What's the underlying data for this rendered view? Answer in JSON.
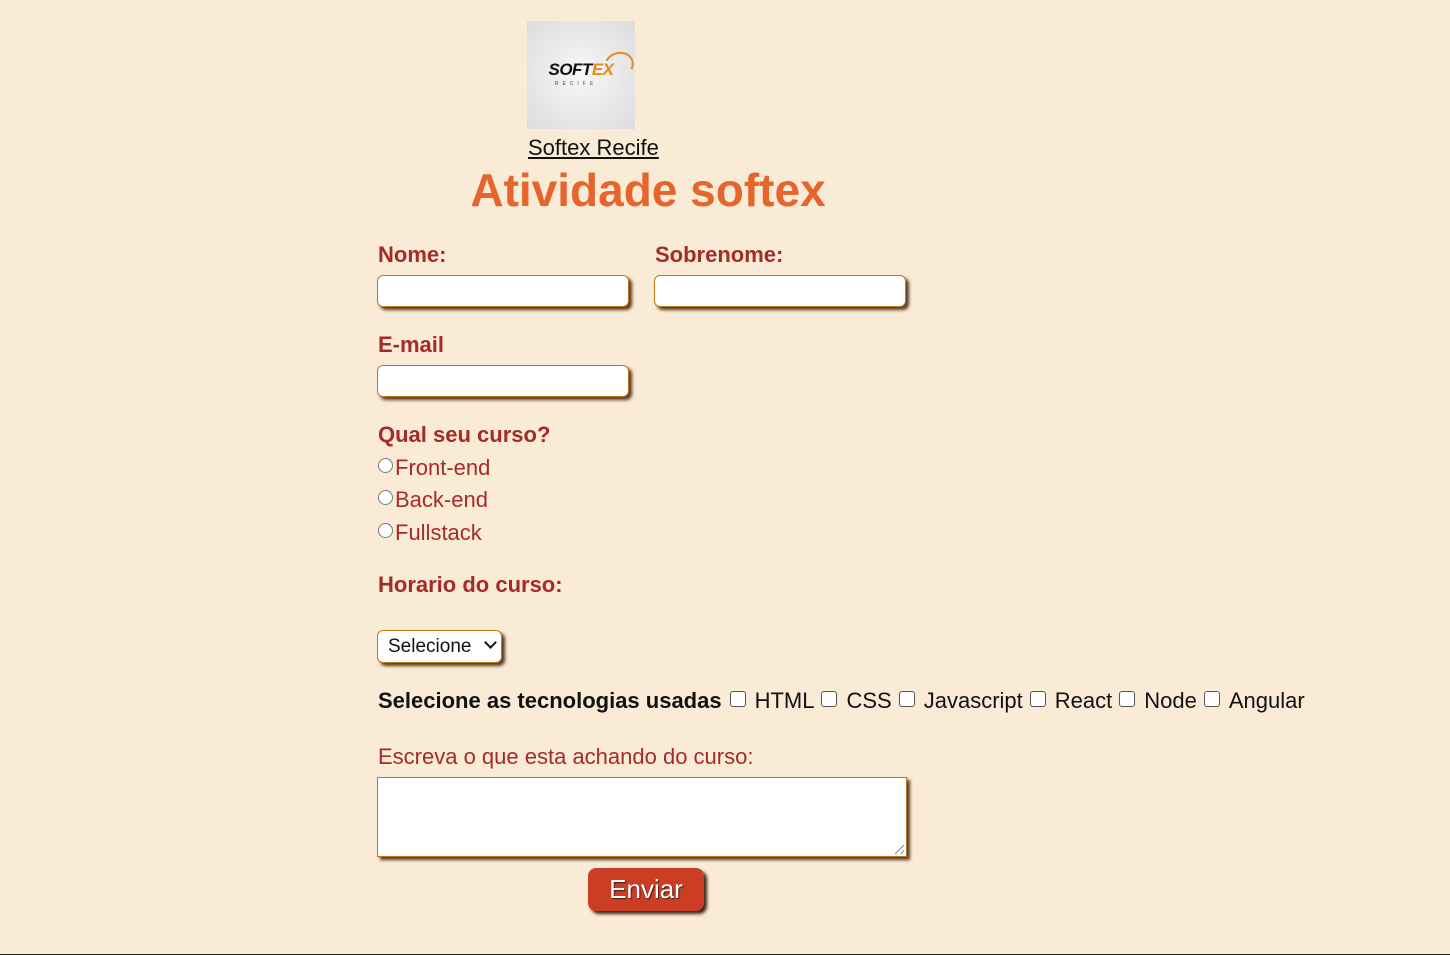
{
  "logo": {
    "text_main": "SOFT",
    "text_accent": "EX",
    "text_sub": "RECIFE"
  },
  "header": {
    "link_text": "Softex Recife",
    "title": "Atividade softex"
  },
  "form": {
    "nome_label": "Nome:",
    "nome_value": "",
    "sobrenome_label": "Sobrenome:",
    "sobrenome_value": "",
    "email_label": "E-mail",
    "email_value": "",
    "curso_label": "Qual seu curso?",
    "curso_options": [
      "Front-end",
      "Back-end",
      "Fullstack"
    ],
    "horario_label": "Horario do curso:",
    "horario_selected": "Selecione",
    "tech_label": "Selecione as tecnologias usadas",
    "tech_options": [
      "HTML",
      "CSS",
      "Javascript",
      "React",
      "Node",
      "Angular"
    ],
    "comment_label": "Escreva o que esta achando do curso:",
    "comment_value": "",
    "submit_label": "Enviar"
  },
  "colors": {
    "background": "#faebd7",
    "title": "#e5652c",
    "label": "#a52a2a",
    "button": "#cc3d26"
  }
}
